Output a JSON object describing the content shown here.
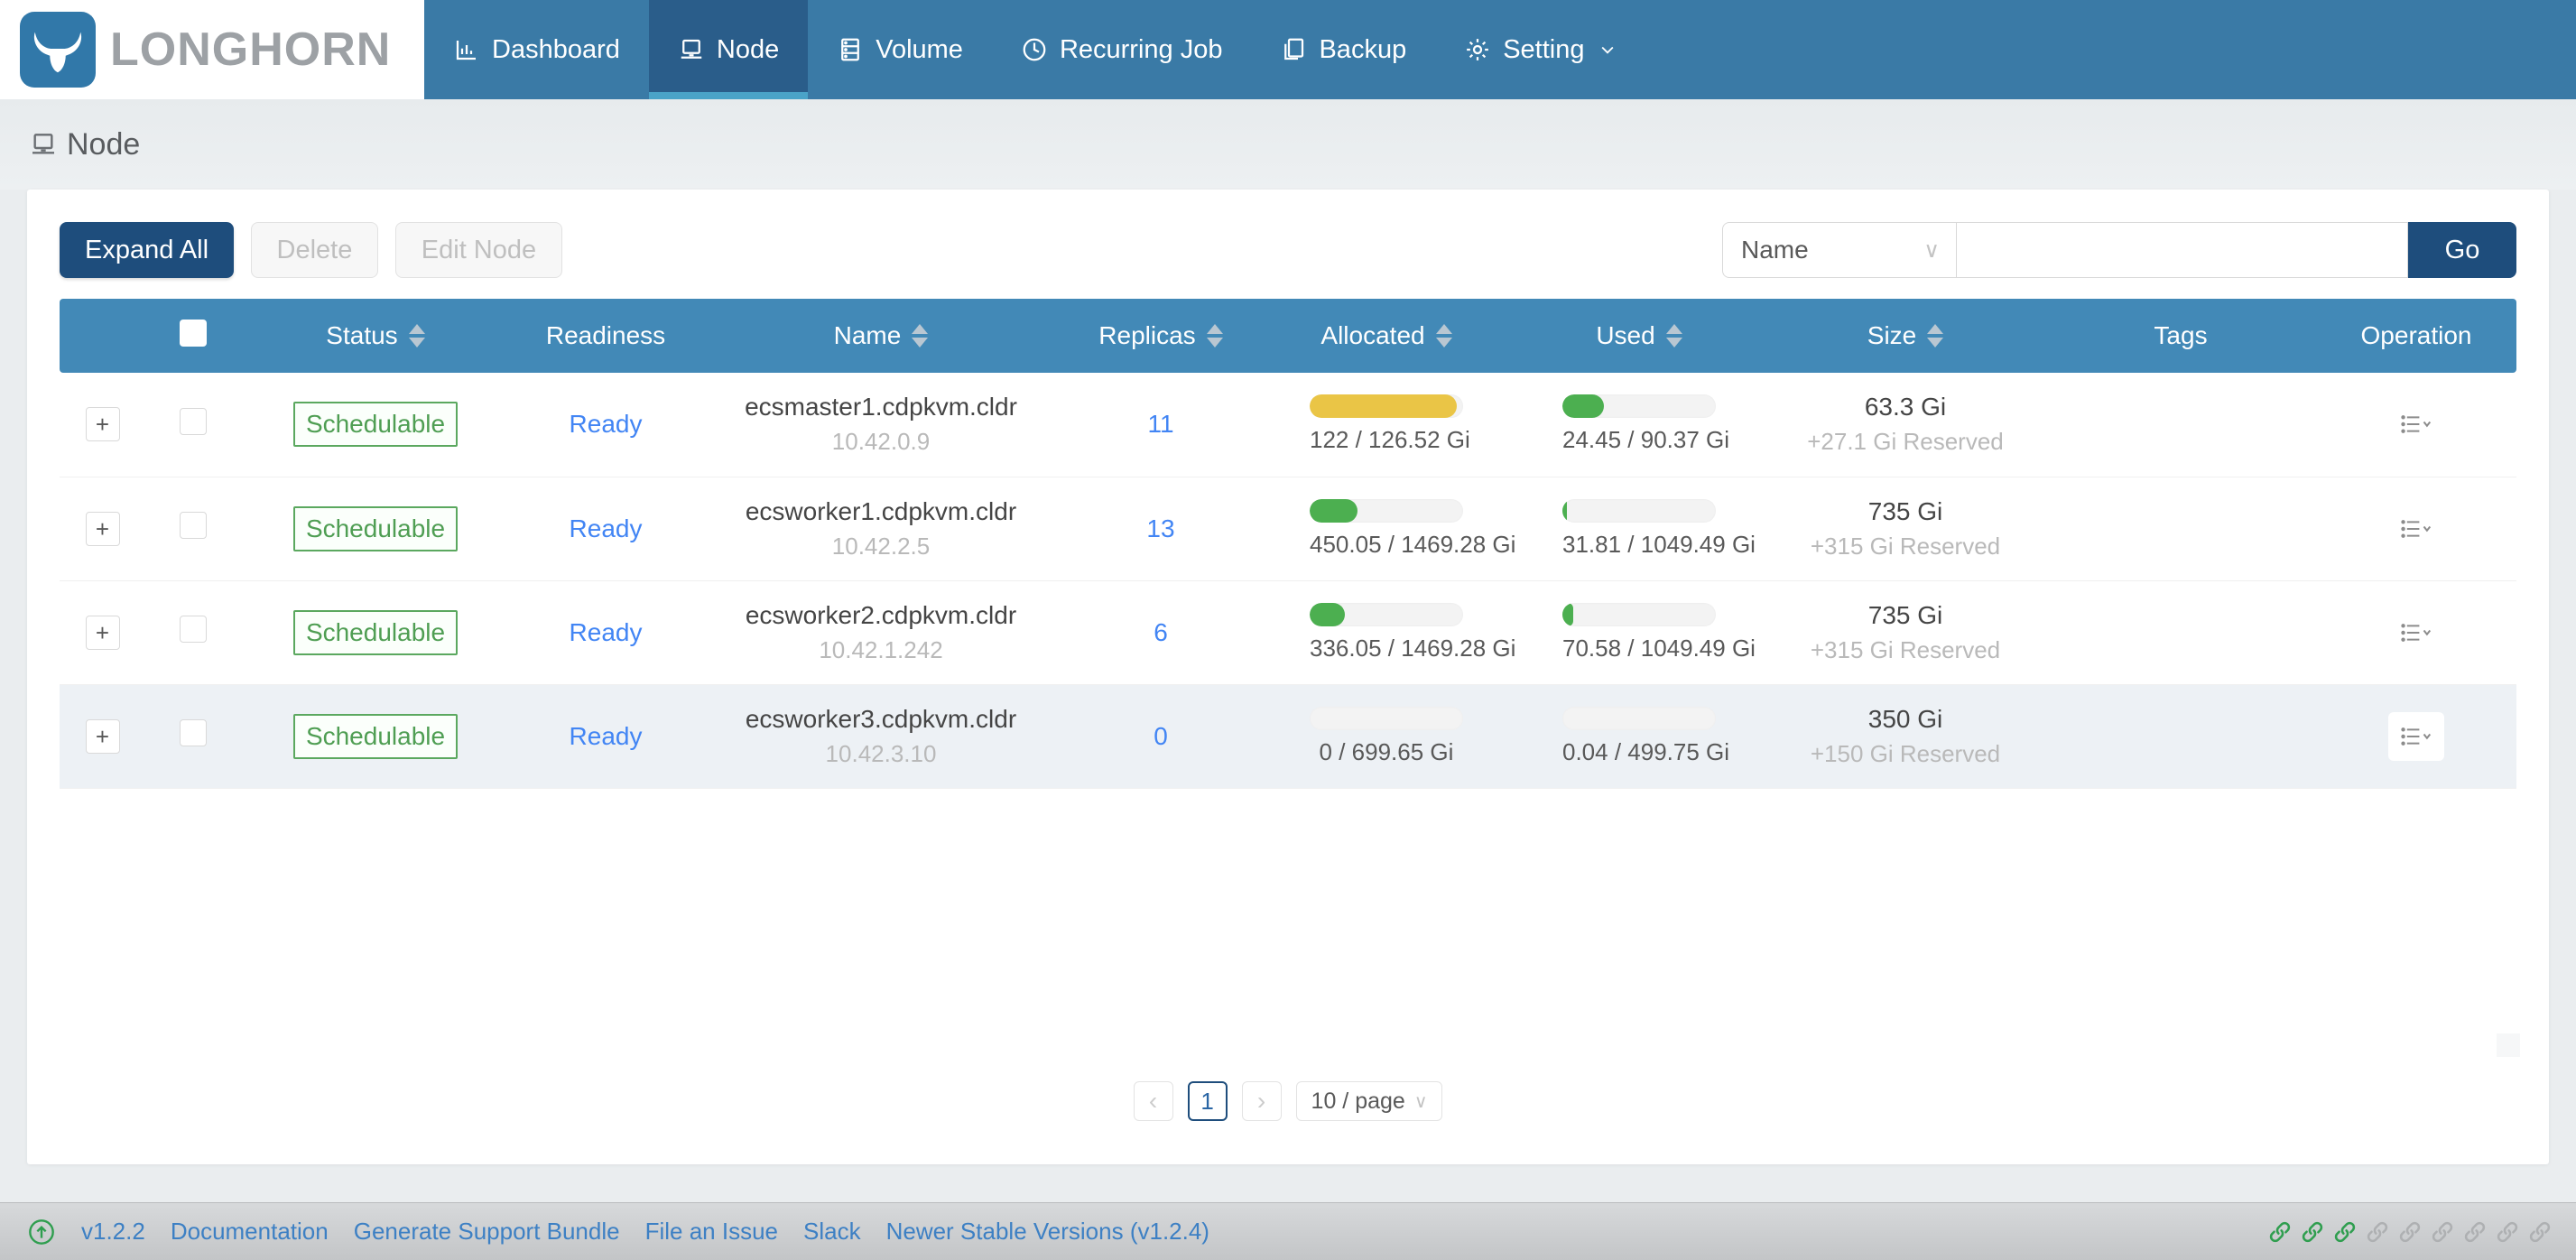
{
  "app": {
    "brand": "LONGHORN"
  },
  "nav": {
    "items": [
      {
        "label": "Dashboard",
        "icon": "dashboard-icon",
        "active": false
      },
      {
        "label": "Node",
        "icon": "node-icon",
        "active": true
      },
      {
        "label": "Volume",
        "icon": "volume-icon",
        "active": false
      },
      {
        "label": "Recurring Job",
        "icon": "recurring-job-icon",
        "active": false
      },
      {
        "label": "Backup",
        "icon": "backup-icon",
        "active": false
      },
      {
        "label": "Setting",
        "icon": "setting-icon",
        "active": false
      }
    ]
  },
  "page": {
    "title": "Node"
  },
  "toolbar": {
    "expand_all": "Expand All",
    "delete": "Delete",
    "edit_node": "Edit Node",
    "filter_field": "Name",
    "search_value": "",
    "go": "Go"
  },
  "table": {
    "columns": [
      {
        "label": "Status",
        "sortable": true
      },
      {
        "label": "Readiness",
        "sortable": false
      },
      {
        "label": "Name",
        "sortable": true
      },
      {
        "label": "Replicas",
        "sortable": true
      },
      {
        "label": "Allocated",
        "sortable": true
      },
      {
        "label": "Used",
        "sortable": true
      },
      {
        "label": "Size",
        "sortable": true
      },
      {
        "label": "Tags",
        "sortable": false
      },
      {
        "label": "Operation",
        "sortable": false
      }
    ],
    "rows": [
      {
        "status": "Schedulable",
        "readiness": "Ready",
        "name": "ecsmaster1.cdpkvm.cldr",
        "ip": "10.42.0.9",
        "replicas": "11",
        "allocated_pct": "96%",
        "allocated_color": "#EAC546",
        "allocated_label": "122 / 126.52 Gi",
        "used_pct": "27%",
        "used_color": "#4CAF50",
        "used_label": "24.45 / 90.37 Gi",
        "size": "63.3 Gi",
        "reserved": "+27.1 Gi Reserved"
      },
      {
        "status": "Schedulable",
        "readiness": "Ready",
        "name": "ecsworker1.cdpkvm.cldr",
        "ip": "10.42.2.5",
        "replicas": "13",
        "allocated_pct": "31%",
        "allocated_color": "#4CAF50",
        "allocated_label": "450.05 / 1469.28 Gi",
        "used_pct": "3%",
        "used_color": "#4CAF50",
        "used_label": "31.81 / 1049.49 Gi",
        "size": "735 Gi",
        "reserved": "+315 Gi Reserved"
      },
      {
        "status": "Schedulable",
        "readiness": "Ready",
        "name": "ecsworker2.cdpkvm.cldr",
        "ip": "10.42.1.242",
        "replicas": "6",
        "allocated_pct": "23%",
        "allocated_color": "#4CAF50",
        "allocated_label": "336.05 / 1469.28 Gi",
        "used_pct": "7%",
        "used_color": "#4CAF50",
        "used_label": "70.58 / 1049.49 Gi",
        "size": "735 Gi",
        "reserved": "+315 Gi Reserved"
      },
      {
        "status": "Schedulable",
        "readiness": "Ready",
        "name": "ecsworker3.cdpkvm.cldr",
        "ip": "10.42.3.10",
        "replicas": "0",
        "allocated_pct": "0%",
        "allocated_color": "#4CAF50",
        "allocated_label": "0 / 699.65 Gi",
        "used_pct": "0%",
        "used_color": "#4CAF50",
        "used_label": "0.04 / 499.75 Gi",
        "size": "350 Gi",
        "reserved": "+150 Gi Reserved",
        "highlighted": true
      }
    ]
  },
  "pagination": {
    "prev": "‹",
    "current": "1",
    "next": "›",
    "page_size": "10 / page"
  },
  "footer": {
    "version": "v1.2.2",
    "links": [
      "Documentation",
      "Generate Support Bundle",
      "File an Issue",
      "Slack",
      "Newer Stable Versions (v1.2.4)"
    ],
    "endpoint_links": [
      "green",
      "green",
      "green",
      "gray",
      "gray",
      "gray",
      "gray",
      "gray",
      "gray"
    ]
  },
  "colors": {
    "nav_bg": "#3a7aa6",
    "nav_active_bg": "#2a5d8a",
    "nav_active_underline": "#4aa3c8",
    "table_header_bg": "#4289b7",
    "primary_button": "#1e4d7c",
    "badge_green": "#5ba85f",
    "link_blue": "#4285f4",
    "bar_yellow": "#EAC546",
    "bar_green": "#4CAF50"
  }
}
